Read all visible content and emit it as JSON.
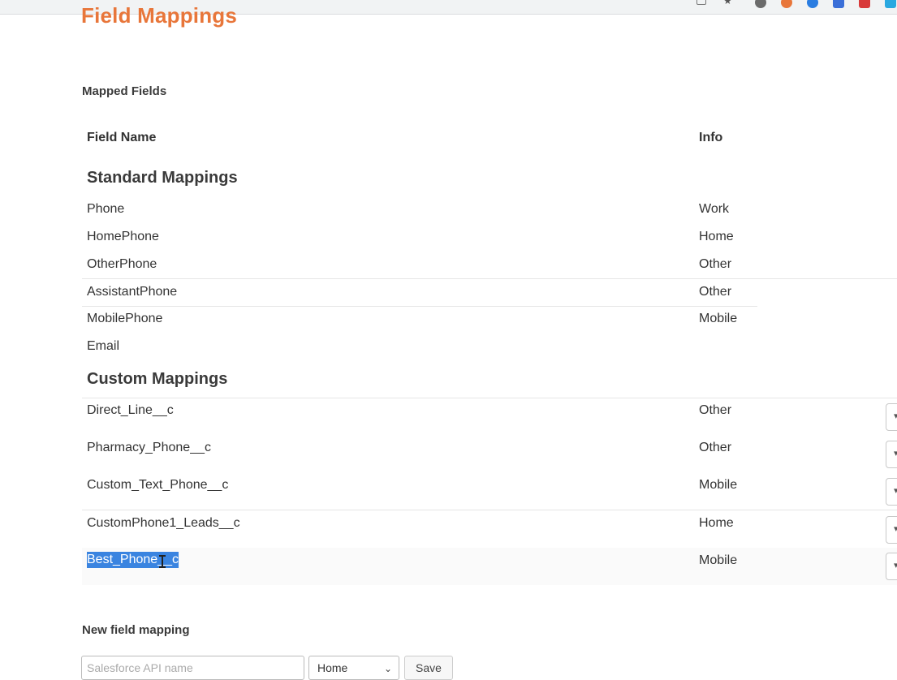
{
  "page": {
    "title": "Field Mappings",
    "mapped_fields_label": "Mapped Fields",
    "new_mapping_label": "New field mapping"
  },
  "table": {
    "headers": {
      "field_name": "Field Name",
      "info": "Info"
    },
    "standard_heading": "Standard Mappings",
    "standard": [
      {
        "name": "Phone",
        "info": "Work"
      },
      {
        "name": "HomePhone",
        "info": "Home"
      },
      {
        "name": "OtherPhone",
        "info": "Other"
      },
      {
        "name": "AssistantPhone",
        "info": "Other"
      },
      {
        "name": "MobilePhone",
        "info": "Mobile"
      },
      {
        "name": "Email",
        "info": ""
      }
    ],
    "custom_heading": "Custom Mappings",
    "custom": [
      {
        "name": "Direct_Line__c",
        "info": "Other"
      },
      {
        "name": "Pharmacy_Phone__c",
        "info": "Other"
      },
      {
        "name": "Custom_Text_Phone__c",
        "info": "Mobile"
      },
      {
        "name": "CustomPhone1_Leads__c",
        "info": "Home"
      },
      {
        "name": "Best_Phone__c",
        "info": "Mobile",
        "selected": true
      }
    ]
  },
  "form": {
    "api_name_placeholder": "Salesforce API name",
    "type_selected": "Home",
    "save_label": "Save"
  },
  "colors": {
    "title": "#e8763a",
    "selection": "#3a84e0"
  },
  "icons": {
    "row_action": "chevron-down-icon",
    "select_chevron": "chevron-down-icon"
  }
}
